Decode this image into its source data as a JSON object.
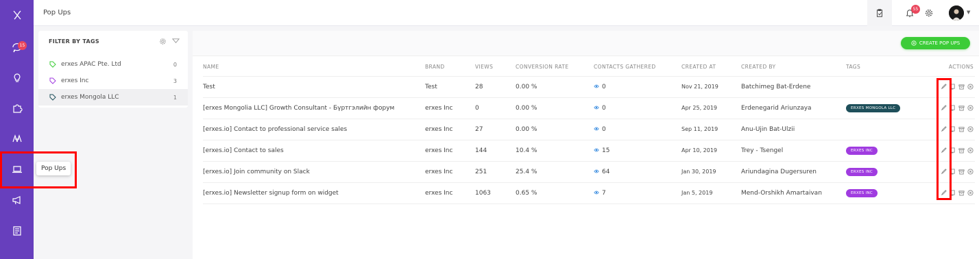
{
  "header": {
    "title": "Pop Ups",
    "notification_count": "55"
  },
  "sidebar": {
    "items": [
      {
        "name": "inbox",
        "badge": "15"
      },
      {
        "name": "growth-hacking"
      },
      {
        "name": "integrations"
      },
      {
        "name": "knowledge-base"
      },
      {
        "name": "pop-ups"
      },
      {
        "name": "engage"
      },
      {
        "name": "reports"
      }
    ],
    "tooltip": "Pop Ups"
  },
  "filter": {
    "title": "FILTER BY TAGS",
    "tags": [
      {
        "label": "erxes APAC Pte. Ltd",
        "count": "0",
        "color": "#3ccc38"
      },
      {
        "label": "erxes Inc",
        "count": "3",
        "color": "#a03ce0"
      },
      {
        "label": "erxes Mongola LLC",
        "count": "1",
        "color": "#1e4f5a"
      }
    ]
  },
  "create_button": "CREATE POP UPS",
  "table": {
    "columns": [
      "NAME",
      "BRAND",
      "VIEWS",
      "CONVERSION RATE",
      "CONTACTS GATHERED",
      "CREATED AT",
      "CREATED BY",
      "TAGS",
      "ACTIONS"
    ],
    "rows": [
      {
        "name": "Test",
        "brand": "Test",
        "views": "28",
        "rate": "0.00 %",
        "contacts": "0",
        "created": "Nov 21, 2019",
        "by": "Batchimeg Bat-Erdene",
        "tag": ""
      },
      {
        "name": "[erxes Mongolia LLC] Growth Consultant - Бүртгэлийн форум",
        "brand": "erxes Inc",
        "views": "0",
        "rate": "0.00 %",
        "contacts": "0",
        "created": "Apr 25, 2019",
        "by": "Erdenegarid Ariunzaya",
        "tag": "ERXES MONGOLA LLC"
      },
      {
        "name": "[erxes.io] Contact to professional service sales",
        "brand": "erxes Inc",
        "views": "27",
        "rate": "0.00 %",
        "contacts": "0",
        "created": "Sep 11, 2019",
        "by": "Anu-Ujin Bat-Ulzii",
        "tag": ""
      },
      {
        "name": "[erxes.io] Contact to sales",
        "brand": "erxes Inc",
        "views": "144",
        "rate": "10.4 %",
        "contacts": "15",
        "created": "Apr 10, 2019",
        "by": "Trey - Tsengel",
        "tag": "ERXES INC"
      },
      {
        "name": "[erxes.io] Join community on Slack",
        "brand": "erxes Inc",
        "views": "251",
        "rate": "25.4 %",
        "contacts": "64",
        "created": "Jan 30, 2019",
        "by": "Ariundagina Dugersuren",
        "tag": "ERXES INC"
      },
      {
        "name": "[erxes.io] Newsletter signup form on widget",
        "brand": "erxes Inc",
        "views": "1063",
        "rate": "0.65 %",
        "contacts": "7",
        "created": "Jan 5, 2019",
        "by": "Mend-Orshikh Amartaivan",
        "tag": "ERXES INC"
      }
    ]
  },
  "colors": {
    "sidebar": "#673fbd",
    "primary_green": "#3ccc38",
    "tag_inc": "#a03ce0",
    "tag_mongola": "#1e4f5a",
    "eye": "#3b8de0",
    "highlight": "#ff0000"
  }
}
